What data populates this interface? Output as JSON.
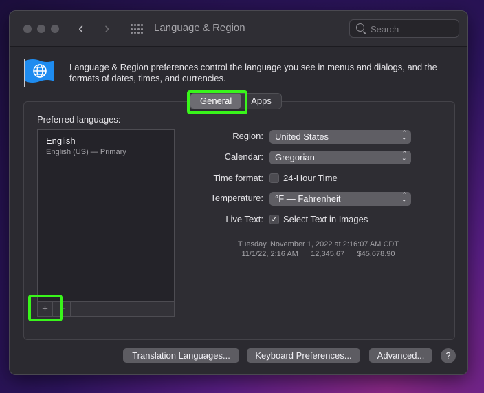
{
  "window": {
    "title": "Language & Region"
  },
  "search": {
    "placeholder": "Search"
  },
  "description": "Language & Region preferences control the language you see in menus and dialogs, and the formats of dates, times, and currencies.",
  "tabs": [
    {
      "label": "General",
      "selected": true
    },
    {
      "label": "Apps",
      "selected": false
    }
  ],
  "preferred": {
    "label": "Preferred languages:",
    "languages": [
      {
        "name": "English",
        "detail": "English (US) — Primary"
      }
    ],
    "add_label": "+",
    "remove_label": "−"
  },
  "settings": {
    "region": {
      "label": "Region:",
      "value": "United States"
    },
    "calendar": {
      "label": "Calendar:",
      "value": "Gregorian"
    },
    "time_format": {
      "label": "Time format:",
      "option": "24-Hour Time",
      "checked": false
    },
    "temperature": {
      "label": "Temperature:",
      "value": "°F — Fahrenheit"
    },
    "live_text": {
      "label": "Live Text:",
      "option": "Select Text in Images",
      "checked": true
    }
  },
  "sample": {
    "date_line": "Tuesday, November 1, 2022 at 2:16:07 AM CDT",
    "short_date": "11/1/22, 2:16 AM",
    "number": "12,345.67",
    "currency": "$45,678.90"
  },
  "buttons": {
    "translation": "Translation Languages...",
    "keyboard": "Keyboard Preferences...",
    "advanced": "Advanced...",
    "help": "?"
  },
  "colors": {
    "highlight": "#39f51b",
    "window_bg": "#2b2a30"
  },
  "icons": [
    "globe-flag-icon",
    "search-icon",
    "grid-icon",
    "back-icon",
    "forward-icon",
    "chevron-updown-icon",
    "checkmark-icon"
  ]
}
